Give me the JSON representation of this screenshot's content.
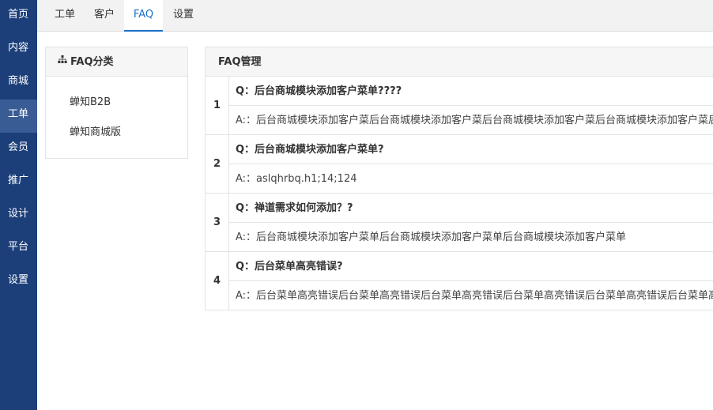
{
  "sidebar": {
    "items": [
      {
        "label": "首页"
      },
      {
        "label": "内容"
      },
      {
        "label": "商城"
      },
      {
        "label": "工单",
        "active": true
      },
      {
        "label": "会员"
      },
      {
        "label": "推广"
      },
      {
        "label": "设计"
      },
      {
        "label": "平台"
      },
      {
        "label": "设置"
      }
    ]
  },
  "tabs": [
    {
      "label": "工单"
    },
    {
      "label": "客户"
    },
    {
      "label": "FAQ",
      "active": true
    },
    {
      "label": "设置"
    }
  ],
  "category_panel": {
    "title": "FAQ分类",
    "icon": "sitemap-icon",
    "items": [
      {
        "label": "蝉知B2B"
      },
      {
        "label": "蝉知商城版"
      }
    ]
  },
  "faq_panel": {
    "title": "FAQ管理",
    "rows": [
      {
        "num": "1",
        "question": "Q：后台商城模块添加客户菜单????",
        "answer": "A:：后台商城模块添加客户菜后台商城模块添加客户菜后台商城模块添加客户菜后台商城模块添加客户菜后台"
      },
      {
        "num": "2",
        "question": "Q：后台商城模块添加客户菜单?",
        "answer": "A:：aslqhrbq.h1;14;124"
      },
      {
        "num": "3",
        "question": "Q：禅道需求如何添加？?",
        "answer": "A:：后台商城模块添加客户菜单后台商城模块添加客户菜单后台商城模块添加客户菜单"
      },
      {
        "num": "4",
        "question": "Q：后台菜单高亮错误?",
        "answer": "A:：后台菜单高亮错误后台菜单高亮错误后台菜单高亮错误后台菜单高亮错误后台菜单高亮错误后台菜单高"
      }
    ]
  },
  "colors": {
    "sidebar_bg": "#1c3f7a",
    "sidebar_active": "#3a5c94",
    "tab_active": "#1c6fc8"
  }
}
